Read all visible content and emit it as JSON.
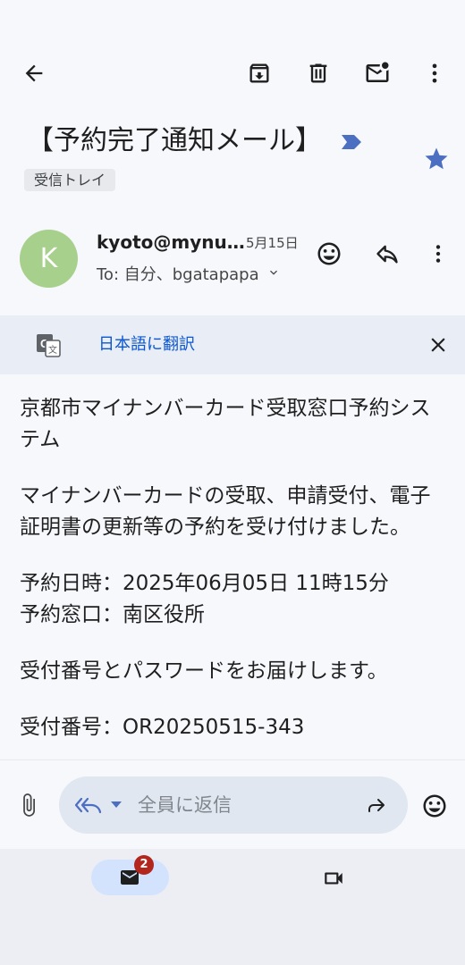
{
  "email": {
    "subject": "【予約完了通知メール】",
    "inbox_label": "受信トレイ",
    "starred": true
  },
  "sender": {
    "avatar_initial": "K",
    "avatar_color": "#a8d08d",
    "name": "kyoto@mynu…",
    "date": "5月15日",
    "recipients": "To: 自分、bgatapapa"
  },
  "translate": {
    "label": "日本語に翻訳"
  },
  "body": {
    "p1": "京都市マイナンバーカード受取窓口予約システム",
    "p2": "マイナンバーカードの受取、申請受付、電子証明書の更新等の予約を受け付けました。",
    "p3_line1": "予約日時：2025年06月05日 11時15分",
    "p3_line2": "予約窓口：南区役所",
    "p4": "受付番号とパスワードをお届けします。",
    "p5_partial": "受付番号：OR20250515-343"
  },
  "reply": {
    "placeholder": "全員に返信"
  },
  "bottom_nav": {
    "mail_badge": "2"
  },
  "colors": {
    "accent": "#0b57d0",
    "star": "#4c6fc2",
    "badge": "#b3261e"
  }
}
